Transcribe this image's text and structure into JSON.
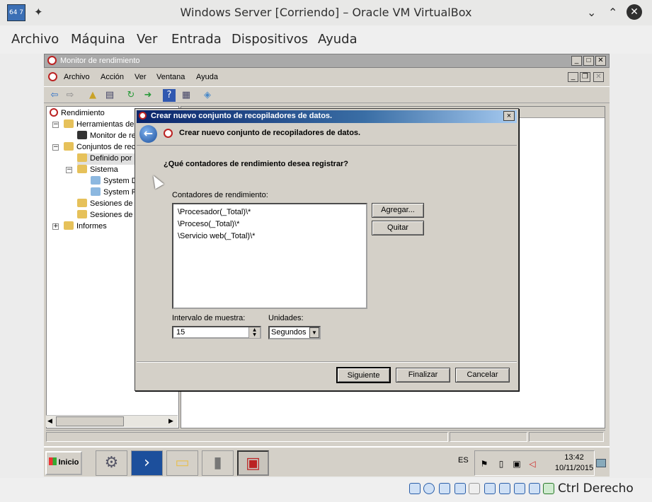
{
  "host": {
    "title": "Windows Server [Corriendo] – Oracle VM VirtualBox",
    "menu": [
      "Archivo",
      "Máquina",
      "Ver",
      "Entrada",
      "Dispositivos",
      "Ayuda"
    ],
    "host_key": "Ctrl Derecho"
  },
  "perfmon": {
    "title": "Monitor de rendimiento",
    "menu": [
      "Archivo",
      "Acción",
      "Ver",
      "Ventana",
      "Ayuda"
    ],
    "tree": [
      {
        "label": "Rendimiento"
      },
      {
        "label": "Herramientas de"
      },
      {
        "label": "Monitor de re"
      },
      {
        "label": "Conjuntos de rec"
      },
      {
        "label": "Definido por"
      },
      {
        "label": "Sistema"
      },
      {
        "label": "System D"
      },
      {
        "label": "System P"
      },
      {
        "label": "Sesiones de"
      },
      {
        "label": "Sesiones de"
      },
      {
        "label": "Informes"
      }
    ]
  },
  "wizard": {
    "title": "Crear nuevo conjunto de recopiladores de datos.",
    "heading": "Crear nuevo conjunto de recopiladores de datos.",
    "question": "¿Qué contadores de rendimiento desea registrar?",
    "counters_label": "Contadores de rendimiento:",
    "counters": [
      "\\Procesador(_Total)\\*",
      "\\Proceso(_Total)\\*",
      "\\Servicio web(_Total)\\*"
    ],
    "add_button": "Agregar...",
    "remove_button": "Quitar",
    "interval_label": "Intervalo de muestra:",
    "interval_value": "15",
    "units_label": "Unidades:",
    "units_value": "Segundos",
    "next_button": "Siguiente",
    "finish_button": "Finalizar",
    "cancel_button": "Cancelar",
    "close_glyph": "×"
  },
  "taskbar": {
    "start_label": "Inicio",
    "language": "ES",
    "time": "13:42",
    "date": "10/11/2015"
  }
}
